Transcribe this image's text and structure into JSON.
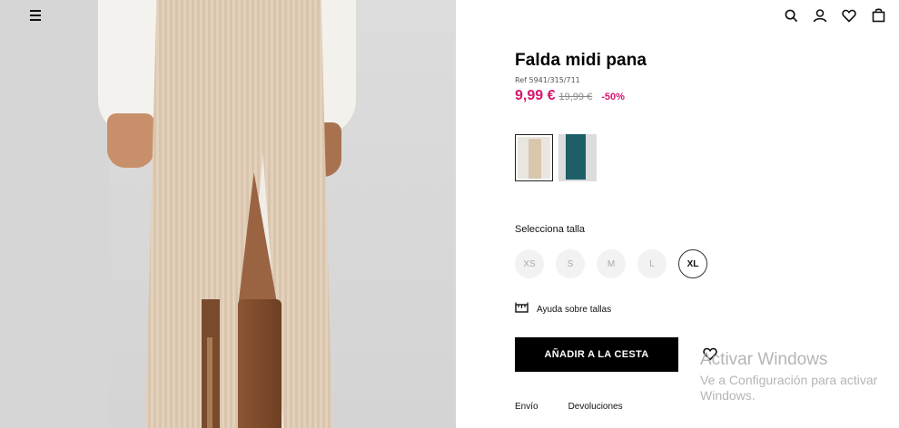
{
  "header": {
    "menu_icon": "hamburger-menu-icon",
    "icons": [
      "search-icon",
      "user-icon",
      "heart-icon",
      "bag-icon"
    ]
  },
  "product": {
    "title": "Falda midi pana",
    "ref": "Ref 5941/315/711",
    "price_now": "9,99 €",
    "price_old": "19,99 €",
    "discount": "-50%",
    "price_color": "#d6176e",
    "colors": [
      {
        "name": "beige",
        "hex": "#d8c6ad",
        "selected": true
      },
      {
        "name": "teal",
        "hex": "#1d5e67",
        "selected": false
      }
    ]
  },
  "size_selector": {
    "label": "Selecciona talla",
    "sizes": [
      {
        "label": "XS",
        "available": false
      },
      {
        "label": "S",
        "available": false
      },
      {
        "label": "M",
        "available": false
      },
      {
        "label": "L",
        "available": false
      },
      {
        "label": "XL",
        "available": true
      }
    ],
    "help_label": "Ayuda sobre tallas",
    "help_icon": "ruler-icon"
  },
  "actions": {
    "add_to_cart": "AÑADIR A LA CESTA",
    "wishlist_icon": "heart-icon"
  },
  "footer_links": {
    "shipping": "Envío",
    "returns": "Devoluciones"
  },
  "watermark": {
    "title": "Activar Windows",
    "subtitle": "Ve a Configuración para activar Windows."
  }
}
